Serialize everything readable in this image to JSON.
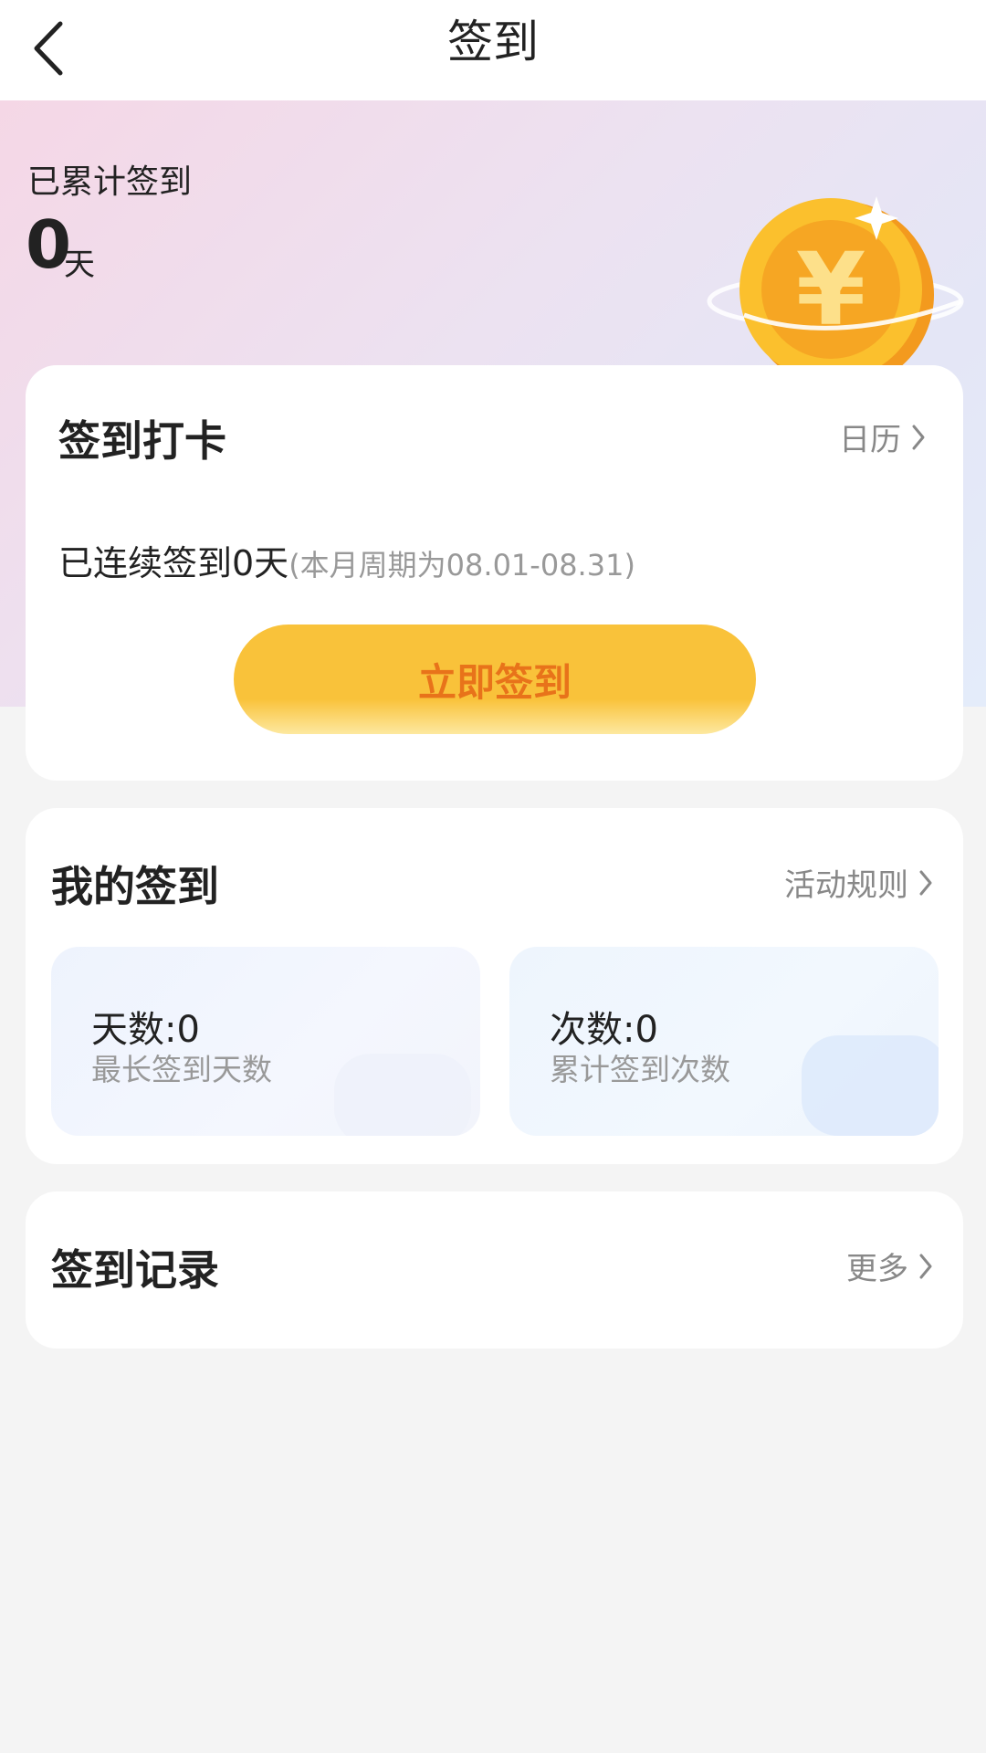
{
  "header": {
    "title": "签到"
  },
  "hero": {
    "total_label": "已累计签到",
    "total_value": "0",
    "total_unit": "天"
  },
  "checkin": {
    "title": "签到打卡",
    "calendar_link": "日历",
    "streak_text": "已连续签到0天",
    "cycle_note": "(本月周期为08.01-08.31)",
    "button_label": "立即签到"
  },
  "my_signin": {
    "title": "我的签到",
    "rules_link": "活动规则",
    "stats": [
      {
        "value": "天数:0",
        "desc": "最长签到天数"
      },
      {
        "value": "次数:0",
        "desc": "累计签到次数"
      }
    ]
  },
  "records": {
    "title": "签到记录",
    "more_link": "更多"
  },
  "colors": {
    "accent": "#f9c23a",
    "button_text": "#e8731a",
    "background": "#f4f4f4"
  },
  "icons": [
    "back-icon",
    "coin-icon",
    "chevron-right-icon"
  ]
}
